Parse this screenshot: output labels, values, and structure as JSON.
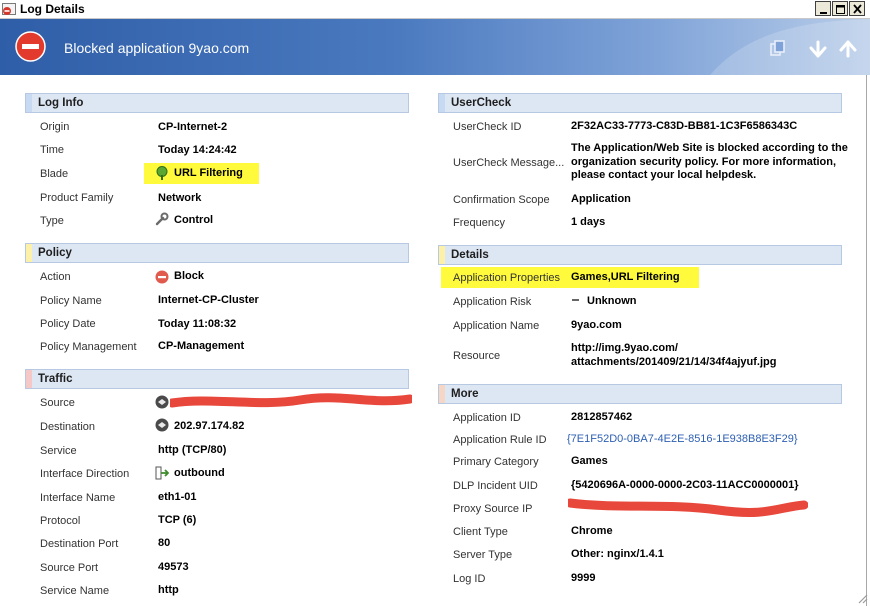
{
  "window": {
    "title": "Log Details"
  },
  "header": {
    "title": "Blocked application 9yao.com"
  },
  "toolbar": {
    "copy_icon": "copy-icon",
    "down_icon": "arrow-down-icon",
    "up_icon": "arrow-up-icon"
  },
  "colors": {
    "highlight": "#fffa3c",
    "log_info_bar": "#c7daf1",
    "policy_bar": "#fdf0a8",
    "traffic_bar": "#f6c7c7",
    "details_bar": "#fdf0a8",
    "more_bar": "#f6d6c4",
    "link": "#2d5fb3"
  },
  "log_info": {
    "header": "Log Info",
    "origin_label": "Origin",
    "origin": "CP-Internet-2",
    "time_label": "Time",
    "time": "Today 14:24:42",
    "blade_label": "Blade",
    "blade": "URL Filtering",
    "product_family_label": "Product Family",
    "product_family": "Network",
    "type_label": "Type",
    "type": "Control"
  },
  "policy": {
    "header": "Policy",
    "action_label": "Action",
    "action": "Block",
    "policy_name_label": "Policy Name",
    "policy_name": "Internet-CP-Cluster",
    "policy_date_label": "Policy Date",
    "policy_date": "Today 11:08:32",
    "policy_management_label": "Policy Management",
    "policy_management": "CP-Management"
  },
  "traffic": {
    "header": "Traffic",
    "source_label": "Source",
    "destination_label": "Destination",
    "destination": "202.97.174.82",
    "service_label": "Service",
    "service": "http (TCP/80)",
    "interface_direction_label": "Interface Direction",
    "interface_direction": "outbound",
    "interface_name_label": "Interface Name",
    "interface_name": "eth1-01",
    "protocol_label": "Protocol",
    "protocol": "TCP (6)",
    "destination_port_label": "Destination Port",
    "destination_port": "80",
    "source_port_label": "Source Port",
    "source_port": "49573",
    "service_name_label": "Service Name",
    "service_name": "http"
  },
  "usercheck": {
    "header": "UserCheck",
    "id_label": "UserCheck ID",
    "id": "2F32AC33-7773-C83D-BB81-1C3F6586343C",
    "message_label": "UserCheck Message...",
    "message": "The Application/Web Site is blocked according to the organization security policy. For more information, please contact your local helpdesk.",
    "confirmation_scope_label": "Confirmation Scope",
    "confirmation_scope": "Application",
    "frequency_label": "Frequency",
    "frequency": "1 days"
  },
  "details": {
    "header": "Details",
    "app_properties_label": "Application Properties",
    "app_properties": "Games,URL Filtering",
    "app_risk_label": "Application Risk",
    "app_risk": "Unknown",
    "app_name_label": "Application Name",
    "app_name": "9yao.com",
    "resource_label": "Resource",
    "resource": "http://img.9yao.com/ attachments/201409/21/14/34f4ajyuf.jpg"
  },
  "more": {
    "header": "More",
    "app_id_label": "Application ID",
    "app_id": "2812857462",
    "app_rule_id_label": "Application Rule ID",
    "app_rule_id": "{7E1F52D0-0BA7-4E2E-8516-1E938B8E3F29}",
    "primary_category_label": "Primary Category",
    "primary_category": "Games",
    "dlp_uid_label": "DLP Incident UID",
    "dlp_uid": "{5420696A-0000-0000-2C03-11ACC0000001}",
    "proxy_source_ip_label": "Proxy Source IP",
    "client_type_label": "Client Type",
    "client_type": "Chrome",
    "server_type_label": "Server Type",
    "server_type": "Other: nginx/1.4.1",
    "log_id_label": "Log ID",
    "log_id": "9999"
  }
}
